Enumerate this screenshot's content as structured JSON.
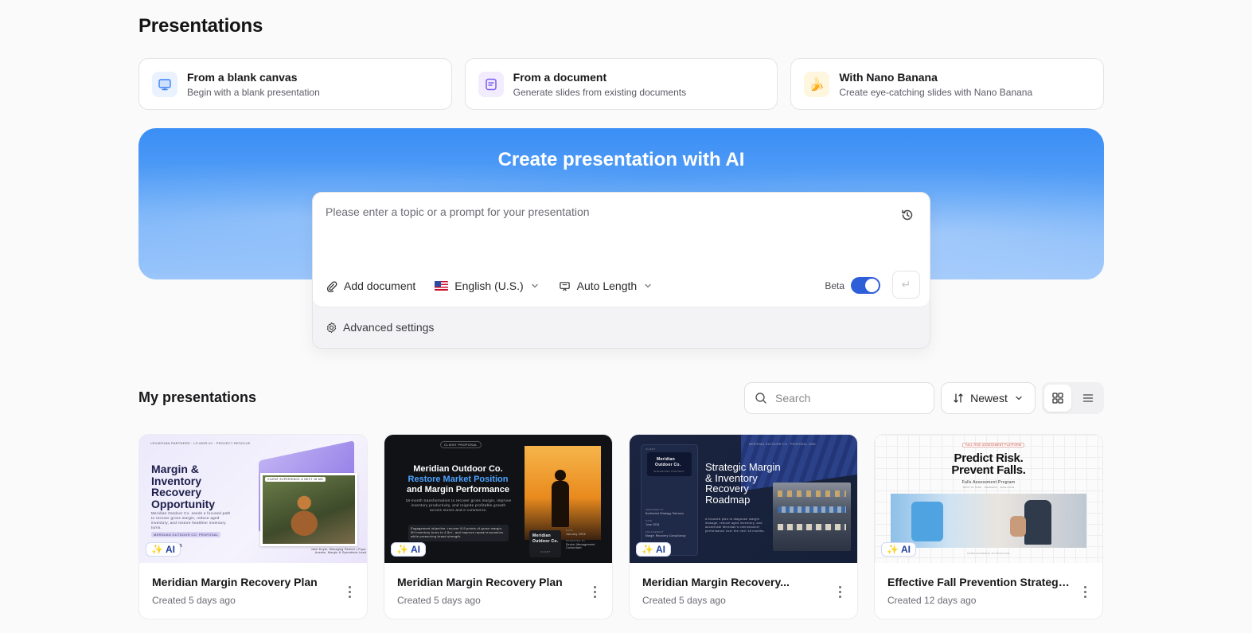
{
  "page": {
    "title": "Presentations"
  },
  "start_options": [
    {
      "title": "From a blank canvas",
      "subtitle": "Begin with a blank presentation",
      "icon": "monitor-icon"
    },
    {
      "title": "From a document",
      "subtitle": "Generate slides from existing documents",
      "icon": "document-icon"
    },
    {
      "title": "With Nano Banana",
      "subtitle": "Create eye-catching slides with Nano Banana",
      "icon": "banana-icon",
      "emoji": "🍌"
    }
  ],
  "hero": {
    "title": "Create presentation with AI",
    "prompt_placeholder": "Please enter a topic or a prompt for your presentation",
    "add_document": "Add document",
    "language": "English (U.S.)",
    "length": "Auto Length",
    "beta_label": "Beta",
    "send_glyph": "↵",
    "advanced_settings": "Advanced settings"
  },
  "my_presentations": {
    "title": "My presentations",
    "search_placeholder": "Search",
    "sort_label": "Newest",
    "ai_badge": "AI",
    "items": [
      {
        "title": "Meridian Margin Recovery Plan",
        "created": "Created 5 days ago",
        "thumb": {
          "header": "LEVIATHAN PARTNERS · LP-MOR-01 · PROJECT RESOLVE",
          "heading_lines": [
            "Margin &",
            "Inventory",
            "Recovery",
            "Opportunity"
          ],
          "body": "Meridian Outdoor Co. needs a focused path to recover gross margin, reduce aged inventory, and restore healthier inventory turns.",
          "tag": "MERIDIAN OUTDOOR CO. PROPOSAL",
          "photo_tag": "CLIENT EXPERIENCE & NEXT 18 MO",
          "footer_right": "Jane Doyle, Managing Partner | Pryor Anselm, Margin & Operations Lead",
          "footer_left": "ners",
          "footer_left_sub": "ate"
        }
      },
      {
        "title": "Meridian Margin Recovery Plan",
        "created": "Created 5 days ago",
        "thumb": {
          "pill": "CLIENT PROPOSAL",
          "line1": "Meridian Outdoor Co.",
          "line2": "Restore Market Position",
          "line3": "and Margin Performance",
          "body": "18-month transformation to recover gross margin, improve inventory productivity, and reignite profitable growth across stores and e-commerce.",
          "objective": "Engagement objective: recover 8-9 points of gross margin, lift inventory turns to 4.5x+, and improve repeat economics while preserving brand strength.",
          "logo_line1": "Meridian",
          "logo_line2": "Outdoor Co.",
          "logo_sub": "CLIENT",
          "meta_date_label": "DATE",
          "meta_date": "January 2026",
          "meta_prep_label": "PREPARED BY",
          "meta_prep": "Senior Management Consultant"
        }
      },
      {
        "title": "Meridian Margin Recovery...",
        "created": "Created 5 days ago",
        "thumb": {
          "header": "MERIDIAN OUTDOOR CO · PROPOSAL 2026",
          "client_label": "CLIENT",
          "logo_line1": "Meridian",
          "logo_line2": "Outdoor Co.",
          "logo_sub": "INTEGRATED STRATEGY",
          "prepared_label": "PREPARED BY",
          "prepared": "Northwind Strategy Partners",
          "date_label": "DATE",
          "date": "June 2026",
          "engagement_label": "ENGAGEMENT",
          "engagement": "Margin Recovery Consultancy",
          "heading_lines": [
            "Strategic Margin",
            "& Inventory",
            "Recovery",
            "Roadmap"
          ],
          "body": "A focused plan to diagnose margin leakage, reduce aged inventory, and accelerate Meridian's omnichannel performance over the next 18 months."
        }
      },
      {
        "title": "Effective Fall Prevention Strategies",
        "created": "Created 12 days ago",
        "thumb": {
          "tag": "FALL RISK ASSESSMENT PLATFORM",
          "line1": "Predict Risk.",
          "line2": "Prevent Falls.",
          "program": "Falls Assessment Program",
          "program_sub": "SPOT AT RISK · PREVENT · EVALUATE",
          "footer": "FROM EVIDENCE TO PRACTICE"
        }
      }
    ]
  },
  "colors": {
    "accent": "#2f5fd8",
    "hero_top": "#3a8ef5",
    "hero_bottom": "#9cc6fb"
  }
}
